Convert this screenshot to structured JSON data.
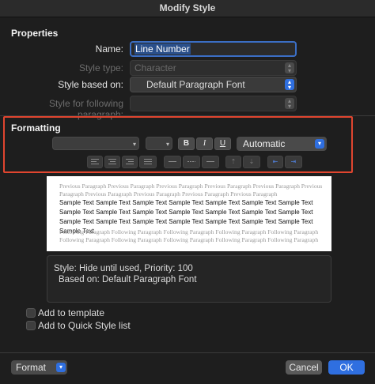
{
  "window": {
    "title": "Modify Style"
  },
  "properties": {
    "heading": "Properties",
    "name_label": "Name:",
    "name_value": "Line Number",
    "style_type_label": "Style type:",
    "style_type_value": "Character",
    "based_on_label": "Style based on:",
    "based_on_value": "Default Paragraph Font",
    "following_label": "Style for following paragraph:",
    "following_value": ""
  },
  "formatting": {
    "heading": "Formatting",
    "font_value": "",
    "size_value": "",
    "bold_label": "B",
    "italic_label": "I",
    "underline_label": "U",
    "color_value": "Automatic"
  },
  "preview": {
    "previous_text": "Previous Paragraph Previous Paragraph Previous Paragraph Previous Paragraph Previous Paragraph Previous Paragraph Previous Paragraph Previous Paragraph Previous Paragraph Previous Paragraph",
    "sample_text": "Sample Text Sample Text Sample Text Sample Text Sample Text Sample Text Sample Text Sample Text Sample Text Sample Text Sample Text Sample Text Sample Text Sample Text Sample Text Sample Text Sample Text Sample Text Sample Text Sample Text Sample Text Sample Text",
    "following_text": "Following Paragraph Following Paragraph Following Paragraph Following Paragraph Following Paragraph Following Paragraph Following Paragraph Following Paragraph Following Paragraph Following Paragraph"
  },
  "description": {
    "line1": "Style: Hide until used, Priority: 100",
    "line2": "Based on: Default Paragraph Font"
  },
  "options": {
    "add_to_template": "Add to template",
    "add_to_quick_style": "Add to Quick Style list"
  },
  "footer": {
    "format_label": "Format",
    "cancel_label": "Cancel",
    "ok_label": "OK"
  },
  "colors": {
    "accent": "#2f6fe0",
    "highlight_border": "#e0452f",
    "background": "#1e1e1e"
  }
}
